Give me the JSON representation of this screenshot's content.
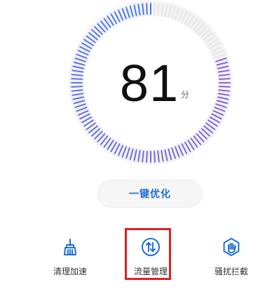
{
  "score": {
    "value": "81",
    "unit": "分",
    "fraction_of_dial": 0.81
  },
  "optimize": {
    "label": "一键优化"
  },
  "actions": [
    {
      "label": "清理加速",
      "icon": "broom-icon"
    },
    {
      "label": "流量管理",
      "icon": "data-traffic-icon",
      "highlighted": true
    },
    {
      "label": "骚扰拦截",
      "icon": "hand-shield-icon"
    }
  ],
  "colors": {
    "accent": "#1f6fd6",
    "tick_blue": "#4a7cf0",
    "tick_purple": "#8a63d8",
    "tick_inactive": "#e6e6e6",
    "highlight": "#e02020"
  }
}
